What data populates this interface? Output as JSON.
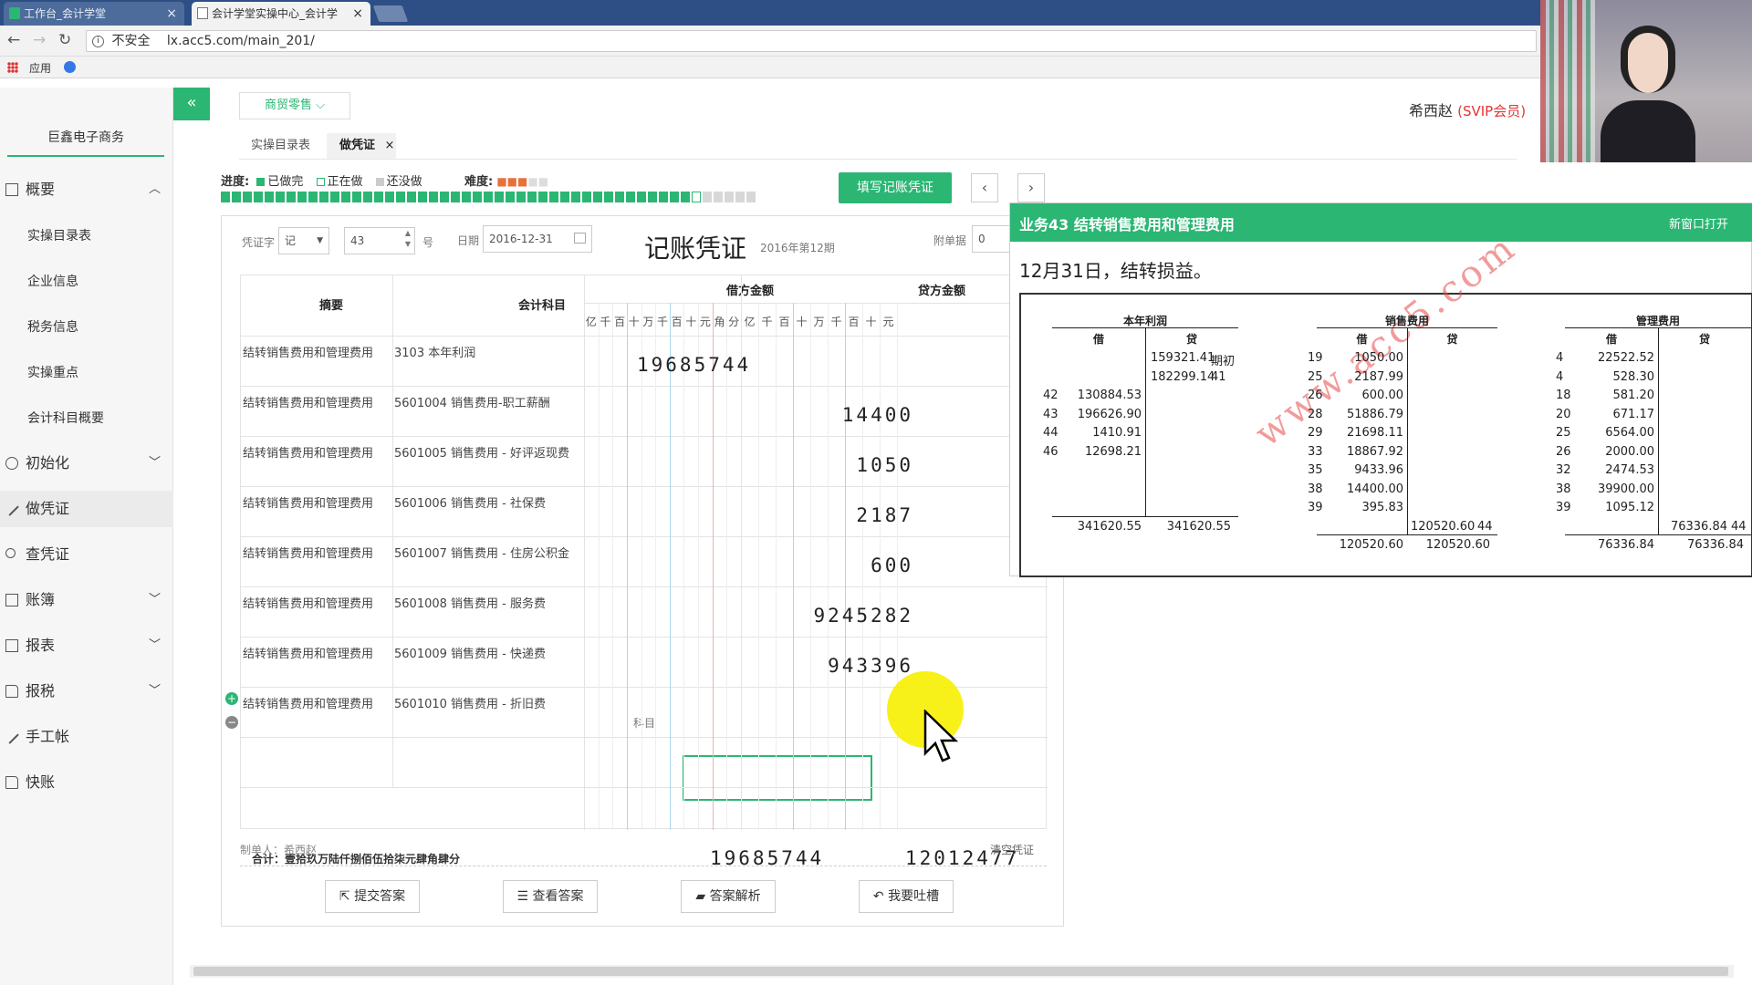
{
  "browser": {
    "tabs": [
      {
        "label": "工作台_会计学堂",
        "close": "×"
      },
      {
        "label": "会计学堂实操中心_会计学",
        "close": "×"
      }
    ],
    "url_insecure": "不安全",
    "url": "lx.acc5.com/main_201/",
    "bookmark_apps": "应用"
  },
  "sidebar": {
    "company": "巨鑫电子商务",
    "overview": "概要",
    "sub_items": [
      "实操目录表",
      "企业信息",
      "税务信息",
      "实操重点",
      "会计科目概要"
    ],
    "items": [
      "初始化",
      "做凭证",
      "查凭证",
      "账簿",
      "报表",
      "报税",
      "手工帐",
      "快账"
    ]
  },
  "topbar": {
    "collapse": "«",
    "store": "商贸零售 ⌵",
    "user": "希西赵",
    "vip": "(SVIP会员)"
  },
  "page_tabs": [
    "实操目录表",
    "做凭证"
  ],
  "page_tab_close": "×",
  "progress": {
    "label": "进度:",
    "done": "已做完",
    "doing": "正在做",
    "todo": "还没做",
    "difficulty": "难度:",
    "done_count": 43,
    "total": 49,
    "colors": {
      "done": "#2bb673",
      "todo": "#d8d8d8",
      "current": "#ffffff"
    }
  },
  "actions": {
    "fill_voucher": "填写记账凭证",
    "prev": "‹",
    "next": "›"
  },
  "voucher": {
    "word_label": "凭证字",
    "word": "记",
    "number": "43",
    "number_unit": "号",
    "date_label": "日期",
    "date": "2016-12-31",
    "title": "记账凭证",
    "period": "2016年第12期",
    "attach_label": "附单据",
    "attach": "0",
    "headers": {
      "summary": "摘要",
      "account": "会计科目",
      "debit": "借方金额",
      "credit": "贷方金额"
    },
    "debit_units": [
      "亿",
      "千",
      "百",
      "十",
      "万",
      "千",
      "百",
      "十",
      "元",
      "角",
      "分"
    ],
    "credit_units": [
      "亿",
      "千",
      "百",
      "十",
      "万",
      "千",
      "百",
      "十",
      "元"
    ],
    "rows": [
      {
        "summary": "结转销售费用和管理费用",
        "account": "3103 本年利润",
        "debit": "19685744",
        "credit": ""
      },
      {
        "summary": "结转销售费用和管理费用",
        "account": "5601004 销售费用-职工薪酬",
        "debit": "",
        "credit": "14400"
      },
      {
        "summary": "结转销售费用和管理费用",
        "account": "5601005 销售费用 - 好评返现费",
        "debit": "",
        "credit": "1050"
      },
      {
        "summary": "结转销售费用和管理费用",
        "account": "5601006 销售费用 - 社保费",
        "debit": "",
        "credit": "2187"
      },
      {
        "summary": "结转销售费用和管理费用",
        "account": "5601007 销售费用 - 住房公积金",
        "debit": "",
        "credit": "600"
      },
      {
        "summary": "结转销售费用和管理费用",
        "account": "5601008 销售费用 - 服务费",
        "debit": "",
        "credit": "924528 2"
      },
      {
        "summary": "结转销售费用和管理费用",
        "account": "5601009 销售费用 - 快递费",
        "debit": "",
        "credit": "943396"
      },
      {
        "summary": "结转销售费用和管理费用",
        "account": "5601010 销售费用 - 折旧费",
        "debit": "",
        "credit": ""
      }
    ],
    "subject_hint": "科目",
    "row_add": "+",
    "row_remove": "−",
    "total_label": "合计：壹拾玖万陆仟捌佰伍拾柒元肆角肆分",
    "total_debit": "19685744",
    "total_credit": "12012477",
    "maker": "制单人：希西赵",
    "clear": "清空凭证",
    "buttons": [
      "提交答案",
      "查看答案",
      "答案解析",
      "我要吐槽"
    ]
  },
  "hint": {
    "title": "业务43 结转销售费用和管理费用",
    "open_new": "新窗口打开",
    "text": "12月31日，结转损益。",
    "watermark": "www.acc5.com",
    "ledgers": [
      {
        "title": "本年利润",
        "debit": "借",
        "credit": "贷",
        "credit_rows": [
          [
            "159321.41",
            "期初"
          ],
          [
            "182299.14",
            "41"
          ]
        ],
        "debit_rows": [
          [
            "42",
            "130884.53"
          ],
          [
            "43",
            "196626.90"
          ],
          [
            "44",
            "1410.91"
          ],
          [
            "46",
            "12698.21"
          ]
        ],
        "totals": [
          "341620.55",
          "341620.55"
        ]
      },
      {
        "title": "销售费用",
        "debit": "借",
        "credit": "贷",
        "debit_rows": [
          [
            "19",
            "1050.00"
          ],
          [
            "25",
            "2187.99"
          ],
          [
            "26",
            "600.00"
          ],
          [
            "28",
            "51886.79"
          ],
          [
            "29",
            "21698.11"
          ],
          [
            "33",
            "18867.92"
          ],
          [
            "35",
            "9433.96"
          ],
          [
            "38",
            "14400.00"
          ],
          [
            "39",
            "395.83"
          ]
        ],
        "credit_rows": [
          [
            "120520.60",
            "44"
          ]
        ],
        "totals": [
          "120520.60",
          "120520.60"
        ]
      },
      {
        "title": "管理费用",
        "debit": "借",
        "credit": "贷",
        "debit_rows": [
          [
            "4",
            "22522.52"
          ],
          [
            "4",
            "528.30"
          ],
          [
            "18",
            "581.20"
          ],
          [
            "20",
            "671.17"
          ],
          [
            "25",
            "6564.00"
          ],
          [
            "26",
            "2000.00"
          ],
          [
            "32",
            "2474.53"
          ],
          [
            "38",
            "39900.00"
          ],
          [
            "39",
            "1095.12"
          ]
        ],
        "credit_rows": [
          [
            "76336.84",
            "44"
          ]
        ],
        "totals": [
          "76336.84",
          "76336.84"
        ]
      }
    ]
  }
}
